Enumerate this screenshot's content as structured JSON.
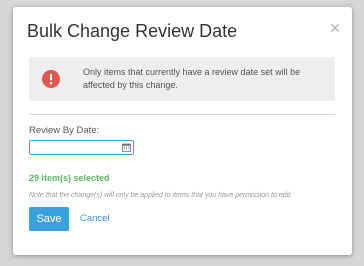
{
  "dialog": {
    "title": "Bulk Change Review Date",
    "close_icon": "close-icon"
  },
  "alert": {
    "icon": "exclamation-circle-icon",
    "icon_color": "#e0574f",
    "message": "Only items that currently have a review date set will be affected by this change."
  },
  "form": {
    "review_by_date_label": "Review By Date:",
    "review_by_date_value": "",
    "calendar_icon": "calendar-icon"
  },
  "selection": {
    "count_text": "29 item(s) selected",
    "color": "#5cb85c"
  },
  "note": "Note that the change(s) will only be applied to items that you have permission to edit.",
  "actions": {
    "save_label": "Save",
    "cancel_label": "Cancel",
    "save_color": "#3aa1e0"
  }
}
